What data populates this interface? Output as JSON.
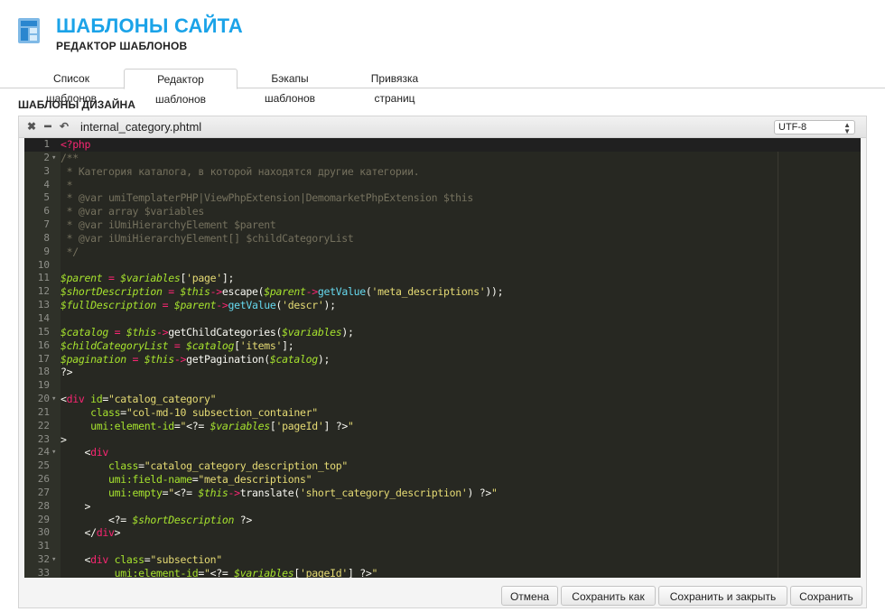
{
  "header": {
    "title": "ШАБЛОНЫ САЙТА",
    "subtitle": "РЕДАКТОР ШАБЛОНОВ"
  },
  "tabs": [
    {
      "label": "Список шаблонов",
      "active": false
    },
    {
      "label": "Редактор шаблонов",
      "active": true
    },
    {
      "label": "Бэкапы шаблонов",
      "active": false
    },
    {
      "label": "Привязка страниц",
      "active": false
    }
  ],
  "section_title": "ШАБЛОНЫ ДИЗАЙНА",
  "editor": {
    "toolbar_icons": [
      "close-icon",
      "minimize-icon",
      "undo-icon"
    ],
    "filename": "internal_category.phtml",
    "encoding": "UTF-8",
    "lines": [
      {
        "n": "1",
        "fold": "",
        "html": "<span class=\"k\">&lt;?php</span>"
      },
      {
        "n": "2",
        "fold": "▾",
        "html": "<span class=\"c\">/**</span>"
      },
      {
        "n": "3",
        "fold": "",
        "html": "<span class=\"c\"> * Категория каталога, в которой находятся другие категории.</span>"
      },
      {
        "n": "4",
        "fold": "",
        "html": "<span class=\"c\"> *</span>"
      },
      {
        "n": "5",
        "fold": "",
        "html": "<span class=\"c\"> * @var umiTemplaterPHP|ViewPhpExtension|DemomarketPhpExtension $this</span>"
      },
      {
        "n": "6",
        "fold": "",
        "html": "<span class=\"c\"> * @var array $variables</span>"
      },
      {
        "n": "7",
        "fold": "",
        "html": "<span class=\"c\"> * @var iUmiHierarchyElement $parent</span>"
      },
      {
        "n": "8",
        "fold": "",
        "html": "<span class=\"c\"> * @var iUmiHierarchyElement[] $childCategoryList</span>"
      },
      {
        "n": "9",
        "fold": "",
        "html": "<span class=\"c\"> */</span>"
      },
      {
        "n": "10",
        "fold": "",
        "html": ""
      },
      {
        "n": "11",
        "fold": "",
        "html": "<span class=\"v\">$parent</span> <span class=\"k\">=</span> <span class=\"v\">$variables</span>[<span class=\"s\">'page'</span>];"
      },
      {
        "n": "12",
        "fold": "",
        "html": "<span class=\"v\">$shortDescription</span> <span class=\"k\">=</span> <span class=\"v\">$this</span><span class=\"k\">-&gt;</span>escape(<span class=\"v\">$parent</span><span class=\"k\">-&gt;</span><span class=\"f\">getValue</span>(<span class=\"s\">'meta_descriptions'</span>));"
      },
      {
        "n": "13",
        "fold": "",
        "html": "<span class=\"v\">$fullDescription</span> <span class=\"k\">=</span> <span class=\"v\">$parent</span><span class=\"k\">-&gt;</span><span class=\"f\">getValue</span>(<span class=\"s\">'descr'</span>);"
      },
      {
        "n": "14",
        "fold": "",
        "html": ""
      },
      {
        "n": "15",
        "fold": "",
        "html": "<span class=\"v\">$catalog</span> <span class=\"k\">=</span> <span class=\"v\">$this</span><span class=\"k\">-&gt;</span>getChildCategories(<span class=\"v\">$variables</span>);"
      },
      {
        "n": "16",
        "fold": "",
        "html": "<span class=\"v\">$childCategoryList</span> <span class=\"k\">=</span> <span class=\"v\">$catalog</span>[<span class=\"s\">'items'</span>];"
      },
      {
        "n": "17",
        "fold": "",
        "html": "<span class=\"v\">$pagination</span> <span class=\"k\">=</span> <span class=\"v\">$this</span><span class=\"k\">-&gt;</span>getPagination(<span class=\"v\">$catalog</span>);"
      },
      {
        "n": "18",
        "fold": "",
        "html": "?&gt;"
      },
      {
        "n": "19",
        "fold": "",
        "html": ""
      },
      {
        "n": "20",
        "fold": "▾",
        "html": "&lt;<span class=\"t\">div</span> <span class=\"a\">id</span>=<span class=\"s\">\"catalog_category\"</span>"
      },
      {
        "n": "21",
        "fold": "",
        "html": "     <span class=\"a\">class</span>=<span class=\"s\">\"col-md-10 subsection_container\"</span>"
      },
      {
        "n": "22",
        "fold": "",
        "html": "     <span class=\"a\">umi:element-id</span>=<span class=\"s\">\"</span>&lt;?= <span class=\"v\">$variables</span>[<span class=\"s\">'pageId'</span>] ?&gt;<span class=\"s\">\"</span>"
      },
      {
        "n": "23",
        "fold": "",
        "html": "&gt;"
      },
      {
        "n": "24",
        "fold": "▾",
        "html": "    &lt;<span class=\"t\">div</span>"
      },
      {
        "n": "25",
        "fold": "",
        "html": "        <span class=\"a\">class</span>=<span class=\"s\">\"catalog_category_description_top\"</span>"
      },
      {
        "n": "26",
        "fold": "",
        "html": "        <span class=\"a\">umi:field-name</span>=<span class=\"s\">\"meta_descriptions\"</span>"
      },
      {
        "n": "27",
        "fold": "",
        "html": "        <span class=\"a\">umi:empty</span>=<span class=\"s\">\"</span>&lt;?= <span class=\"v\">$this</span><span class=\"k\">-&gt;</span>translate(<span class=\"s\">'short_category_description'</span>) ?&gt;<span class=\"s\">\"</span>"
      },
      {
        "n": "28",
        "fold": "",
        "html": "    &gt;"
      },
      {
        "n": "29",
        "fold": "",
        "html": "        &lt;?= <span class=\"v\">$shortDescription</span> ?&gt;"
      },
      {
        "n": "30",
        "fold": "",
        "html": "    &lt;/<span class=\"t\">div</span>&gt;"
      },
      {
        "n": "31",
        "fold": "",
        "html": ""
      },
      {
        "n": "32",
        "fold": "▾",
        "html": "    &lt;<span class=\"t\">div</span> <span class=\"a\">class</span>=<span class=\"s\">\"subsection\"</span>"
      },
      {
        "n": "33",
        "fold": "",
        "html": "         <span class=\"a\">umi:element-id</span>=<span class=\"s\">\"</span>&lt;?= <span class=\"v\">$variables</span>[<span class=\"s\">'pageId'</span>] ?&gt;<span class=\"s\">\"</span>"
      }
    ]
  },
  "buttons": {
    "cancel": "Отмена",
    "save_as": "Сохранить как",
    "save_close": "Сохранить и закрыть",
    "save": "Сохранить"
  }
}
